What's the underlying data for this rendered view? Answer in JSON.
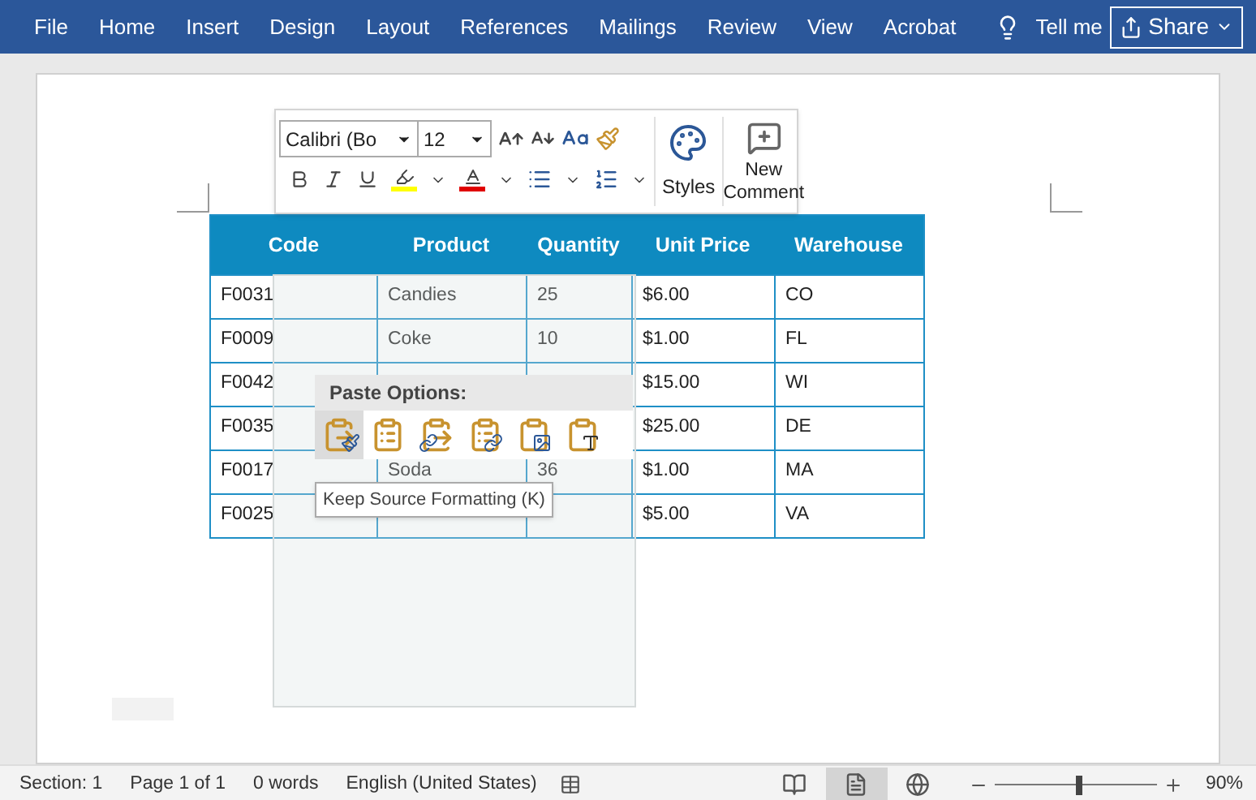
{
  "menu": {
    "tabs": [
      {
        "label": "File"
      },
      {
        "label": "Home"
      },
      {
        "label": "Insert"
      },
      {
        "label": "Design"
      },
      {
        "label": "Layout"
      },
      {
        "label": "References"
      },
      {
        "label": "Mailings"
      },
      {
        "label": "Review"
      },
      {
        "label": "View"
      },
      {
        "label": "Acrobat"
      }
    ],
    "tell_me": "Tell me",
    "share": "Share"
  },
  "mini_toolbar": {
    "font": "Calibri (Bo",
    "size": "12",
    "styles": "Styles",
    "new_comment": "New Comment"
  },
  "table": {
    "columns": [
      "Code",
      "Product",
      "Quantity",
      "Unit Price",
      "Warehouse"
    ],
    "rows": [
      [
        "F0031",
        "Candies",
        "25",
        "$6.00",
        "CO"
      ],
      [
        "F0009",
        "Coke",
        "10",
        "$1.00",
        "FL"
      ],
      [
        "F0042",
        null,
        null,
        "$15.00",
        "WI"
      ],
      [
        "F0035",
        null,
        null,
        "$25.00",
        "DE"
      ],
      [
        "F0017",
        "Soda",
        "36",
        "$1.00",
        "MA"
      ],
      [
        "F0025",
        null,
        null,
        "$5.00",
        "VA"
      ]
    ]
  },
  "paste_options": {
    "title": "Paste Options:",
    "options": [
      {
        "kind": "keep-source",
        "selected": true
      },
      {
        "kind": "merge",
        "selected": false
      },
      {
        "kind": "link-keep",
        "selected": false
      },
      {
        "kind": "link-merge",
        "selected": false
      },
      {
        "kind": "picture",
        "selected": false
      },
      {
        "kind": "text-only",
        "selected": false
      }
    ],
    "tooltip": "Keep Source Formatting (K)"
  },
  "status_bar": {
    "section": "Section: 1",
    "page": "Page 1 of 1",
    "words": "0 words",
    "language": "English (United States)",
    "views": [
      {
        "kind": "read",
        "selected": false
      },
      {
        "kind": "print",
        "selected": true
      },
      {
        "kind": "web",
        "selected": false
      }
    ],
    "zoom": {
      "level": 0.52,
      "reading": "90%"
    }
  }
}
